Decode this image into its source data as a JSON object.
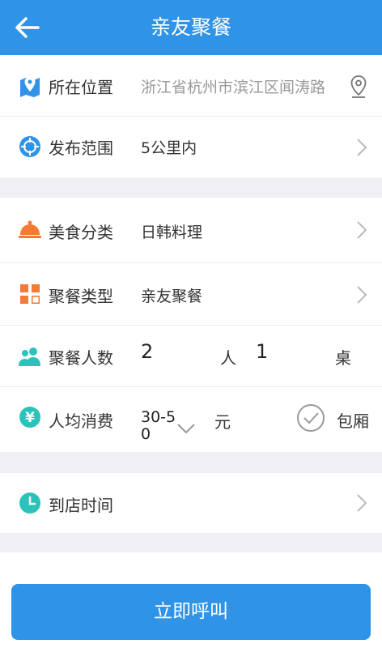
{
  "header": {
    "title": "亲友聚餐"
  },
  "location": {
    "label": "所在位置",
    "value": "浙江省杭州市滨江区闻涛路"
  },
  "range": {
    "label": "发布范围",
    "value": "5公里内"
  },
  "cuisine": {
    "label": "美食分类",
    "value": "日韩料理"
  },
  "meal_type": {
    "label": "聚餐类型",
    "value": "亲友聚餐"
  },
  "people": {
    "label": "聚餐人数",
    "count": "2",
    "count_unit": "人",
    "tables": "1",
    "tables_unit": "桌"
  },
  "per_person": {
    "label": "人均消费",
    "value": "30-50",
    "unit": "元",
    "private_room_label": "包厢"
  },
  "arrival": {
    "label": "到店时间"
  },
  "action": {
    "call_label": "立即呼叫"
  },
  "colors": {
    "primary": "#2f93e8",
    "orange": "#f47a36",
    "teal": "#2bc3b9"
  }
}
